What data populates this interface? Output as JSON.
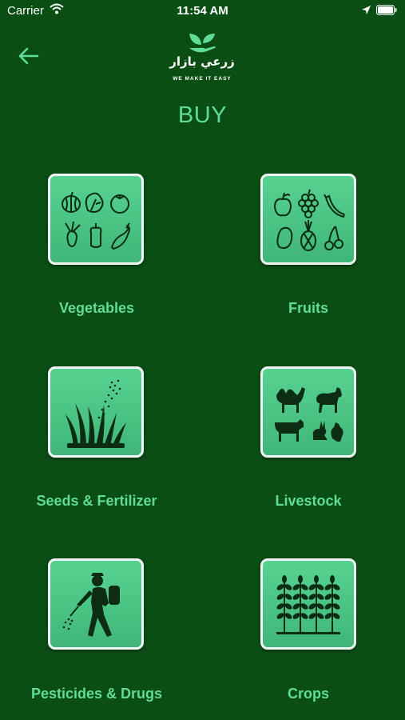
{
  "status": {
    "carrier": "Carrier",
    "time": "11:54 AM"
  },
  "icons": {
    "back": "arrow-left-icon",
    "logo": "leaf-hand-logo",
    "wifi": "wifi-icon",
    "location": "location-arrow-icon",
    "battery": "battery-icon"
  },
  "logo": {
    "arabic": "زرعي بازار",
    "tagline": "WE MAKE IT EASY"
  },
  "title": "BUY",
  "colors": {
    "background": "#0a4e14",
    "accent": "#5fdc98",
    "tile": "#4cc585",
    "tile_border": "#f3f8f4"
  },
  "categories": [
    {
      "label": "Vegetables",
      "icon": "vegetables-icon"
    },
    {
      "label": "Fruits",
      "icon": "fruits-icon"
    },
    {
      "label": "Seeds & Fertilizer",
      "icon": "seeds-grass-icon"
    },
    {
      "label": "Livestock",
      "icon": "livestock-icon"
    },
    {
      "label": "Pesticides & Drugs",
      "icon": "sprayer-person-icon"
    },
    {
      "label": "Crops",
      "icon": "crops-icon"
    }
  ]
}
